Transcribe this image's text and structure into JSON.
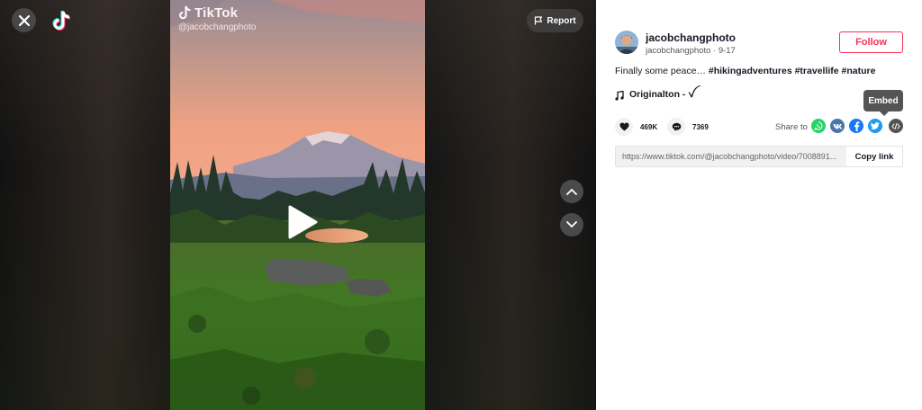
{
  "header": {
    "report_label": "Report"
  },
  "watermark": {
    "brand": "TikTok",
    "handle": "@jacobchangphoto"
  },
  "icons": {
    "close": "close-icon",
    "logo": "tiktok-logo-icon",
    "flag": "flag-icon",
    "play": "play-icon",
    "up": "chevron-up-icon",
    "down": "chevron-down-icon",
    "music": "music-note-icon",
    "heart": "heart-icon",
    "comment": "comment-icon",
    "whatsapp": "whatsapp-icon",
    "vk": "vk-icon",
    "facebook": "facebook-icon",
    "twitter": "twitter-icon",
    "embed": "embed-code-icon"
  },
  "author": {
    "username": "jacobchangphoto",
    "handle": "jacobchangphoto",
    "date": "9-17",
    "follow_label": "Follow"
  },
  "caption": {
    "text": "Finally some peace… ",
    "tags": [
      "#hikingadventures",
      "#travellife",
      "#nature"
    ]
  },
  "music": {
    "title": "Originalton - ",
    "suffix": "ꪜ"
  },
  "stats": {
    "likes": "469K",
    "comments": "7369"
  },
  "share": {
    "label": "Share to",
    "tooltip": "Embed"
  },
  "link": {
    "url": "https://www.tiktok.com/@jacobchangphoto/video/7008891...",
    "copy_label": "Copy link"
  },
  "colors": {
    "accent": "#fe2c55",
    "whatsapp": "#25d366",
    "vk": "#4a76a8",
    "facebook": "#1877f2",
    "twitter": "#1d9bf0",
    "embed": "#545454"
  }
}
